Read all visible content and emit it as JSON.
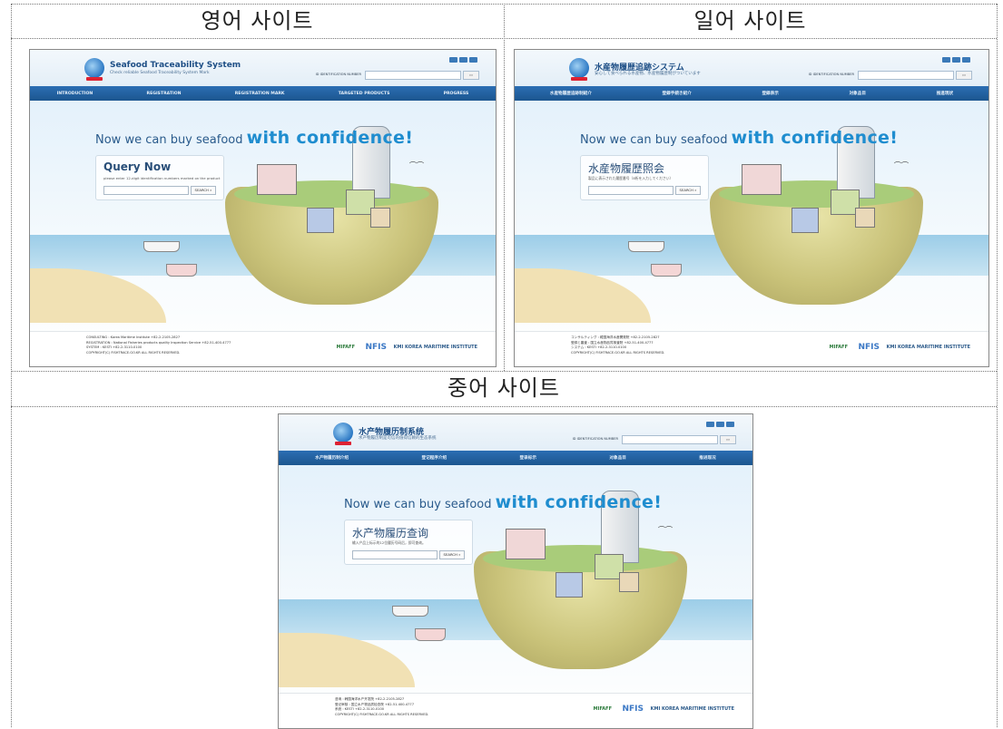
{
  "panels": [
    {
      "caption": "영어 사이트",
      "logo_title": "Seafood Traceability System",
      "logo_sub": "Check reliable Seafood Traceability System Mark",
      "id_label": "ID IDENTIFICATION NUMBER",
      "id_button": "»»",
      "nav": [
        "INTRODUCTION",
        "REGISTRATION",
        "REGISTRATION MARK",
        "TARGETED PRODUCTS",
        "PROGRESS"
      ],
      "headline_a": "Now we can buy seafood",
      "headline_b": "with confidence!",
      "query_title": "Query Now",
      "query_sub": "please enter 12-digit identification numbers marked on the product",
      "search_button": "SEARCH »",
      "footer": [
        "CONSULTING : Korea Maritime Institute +82-2-2105-2827",
        "REGISTRATION : National Fisheries products quality Inspection Service +82-51-400-4777",
        "SYSTEM : KESTI +82-2-3110-0100",
        "COPYRIGHT(C) FISHTRACE.GO.KR ALL RIGHTS RESERVED."
      ]
    },
    {
      "caption": "일어 사이트",
      "logo_title": "水産物履歴追跡システム",
      "logo_sub": "安心して食べられる水産物、水産物履歴制がついています",
      "id_label": "ID IDENTIFICATION NUMBER",
      "id_button": "»»",
      "nav": [
        "水産物履歴追跡制紹介",
        "登録手続き紹介",
        "登録表示",
        "対象品目",
        "推進現状"
      ],
      "headline_a": "Now we can buy seafood",
      "headline_b": "with confidence!",
      "query_title": "水産物履歴照会",
      "query_sub": "製品に表示された履歴番号（8桁を入力してください）",
      "search_button": "SEARCH »",
      "footer": [
        "コンサルティング : 韓国海洋水産開発院 +82-2-2105-2827",
        "登録と審査 : 国立水産物品質検査院 +82-51-400-4777",
        "システム : KESTI +82-2-3110-0100",
        "COPYRIGHT(C) FISHTRACE.GO.KR ALL RIGHTS RESERVED."
      ]
    },
    {
      "caption": "중어 사이트",
      "logo_title": "水产物履历制系统",
      "logo_sub": "水产物履历制是可信的值得信赖的生态系统",
      "id_label": "ID IDENTIFICATION NUMBER",
      "id_button": "»»",
      "nav": [
        "水产物履历制介绍",
        "登记程序介绍",
        "登录标示",
        "对象品目",
        "推进现况"
      ],
      "headline_a": "Now we can buy seafood",
      "headline_b": "with confidence!",
      "query_title": "水产物履历查询",
      "query_sub": "输入产品上标示的12位履历号码后，即可查询。",
      "search_button": "SEARCH »",
      "footer": [
        "咨询 : 韩国海洋水产开发院 +82-2-2105-2827",
        "登记审核 : 国立水产物品质检查院 +82-51-400-4777",
        "系统 : KESTI +82-2-3110-0100",
        "COPYRIGHT(C) FISHTRACE.GO.KR ALL RIGHTS RESERVED."
      ]
    }
  ],
  "footer_logos": [
    "MIFAFF",
    "NFIS",
    "KMI KOREA MARITIME INSTITUTE"
  ],
  "colors": {
    "nav": "#1f5f9f",
    "accent": "#1f8dcf",
    "sand": "#f1e1b4",
    "sea": "#9ccde8"
  }
}
